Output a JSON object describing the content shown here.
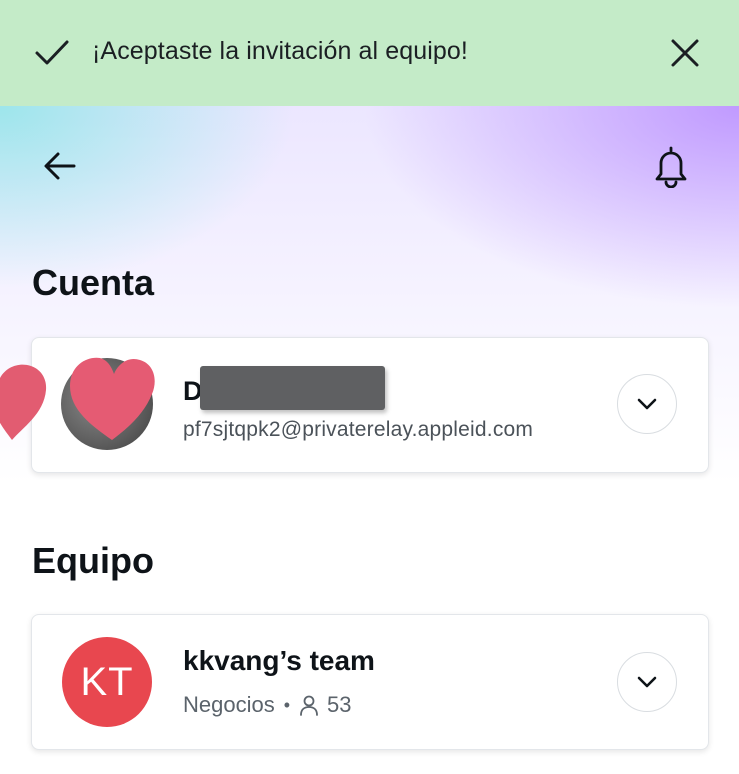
{
  "toast": {
    "message": "¡Aceptaste la invitación al equipo!",
    "icon": "check-icon",
    "close_icon": "close-icon",
    "color": "#c4ebc8"
  },
  "header": {
    "back_icon": "arrow-left-icon",
    "notifications_icon": "bell-icon"
  },
  "account": {
    "section_title": "Cuenta",
    "name_visible": "D",
    "email": "pf7sjtqpk2@privaterelay.appleid.com",
    "expand_icon": "chevron-down-icon"
  },
  "team": {
    "section_title": "Equipo",
    "avatar_initials": "KT",
    "avatar_color": "#e8474f",
    "name": "kkvang’s team",
    "plan": "Negocios",
    "separator": "•",
    "members_icon": "person-icon",
    "member_count": "53",
    "expand_icon": "chevron-down-icon"
  }
}
